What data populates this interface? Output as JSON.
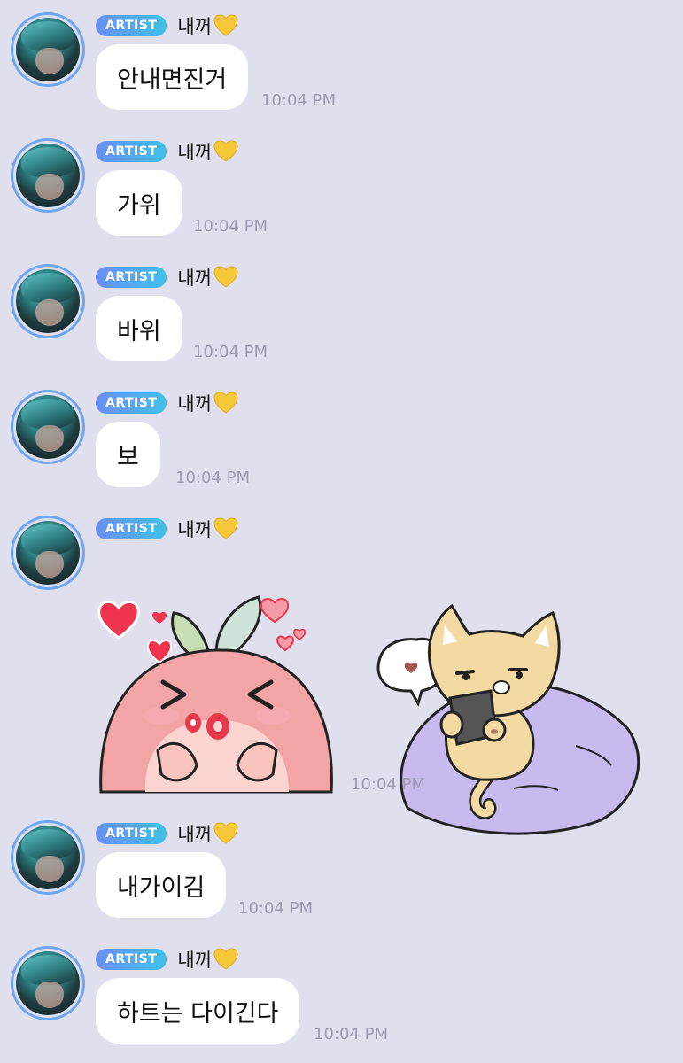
{
  "badge_label": "ARTIST",
  "sender_name": "내꺼",
  "colors": {
    "background": "#e0dfee",
    "badge_start": "#6b8ef5",
    "badge_end": "#3fc1e8",
    "avatar_ring": "#6fa6ec",
    "bubble": "#ffffff",
    "timestamp": "#9c9aaf"
  },
  "messages": [
    {
      "text": "안내면진거",
      "time": "10:04 PM"
    },
    {
      "text": "가위",
      "time": "10:04 PM"
    },
    {
      "text": "바위",
      "time": "10:04 PM"
    },
    {
      "text": "보",
      "time": "10:04 PM"
    },
    {
      "sticker_pair": [
        "peach-kiss-sticker",
        "cat-phone-sticker"
      ],
      "time": "10:04 PM"
    },
    {
      "text": "내가이김",
      "time": "10:04 PM"
    },
    {
      "text": "하트는 다이긴다",
      "time": "10:04 PM"
    }
  ]
}
